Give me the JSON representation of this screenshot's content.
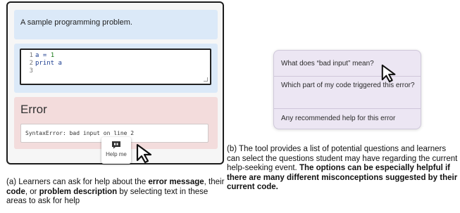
{
  "panel_a": {
    "problem_text": "A sample programming problem.",
    "code_lines": [
      {
        "num": "1",
        "text": "a = ",
        "value": "1"
      },
      {
        "num": "2",
        "text": "print a",
        "value": ""
      },
      {
        "num": "3",
        "text": "",
        "value": ""
      }
    ],
    "error_title": "Error",
    "error_message": "SyntaxError: bad input on line 2",
    "help_button_label": "Help me"
  },
  "panel_b": {
    "options": [
      "What does “bad input” mean?",
      "Which part of my code triggered this error?",
      "Any recommended help for this error"
    ]
  },
  "caption_a": {
    "t1": "(a) Learners can ask for help about the ",
    "b1": "error message",
    "t2": ", their ",
    "b2": "code",
    "t3": ", or ",
    "b3": "problem description",
    "t4": " by selecting text in these areas to ask for help"
  },
  "caption_b": {
    "text": "(b) The tool provides a list of potential questions and learners can select the questions student may have regarding the current help-seeking event. ",
    "bold": "The options can be especially helpful if there are many different misconceptions suggested by their current code."
  },
  "colors": {
    "problem_bg": "#dbe9f8",
    "error_bg": "#f3dcdc",
    "options_bg": "#ece6f3"
  }
}
